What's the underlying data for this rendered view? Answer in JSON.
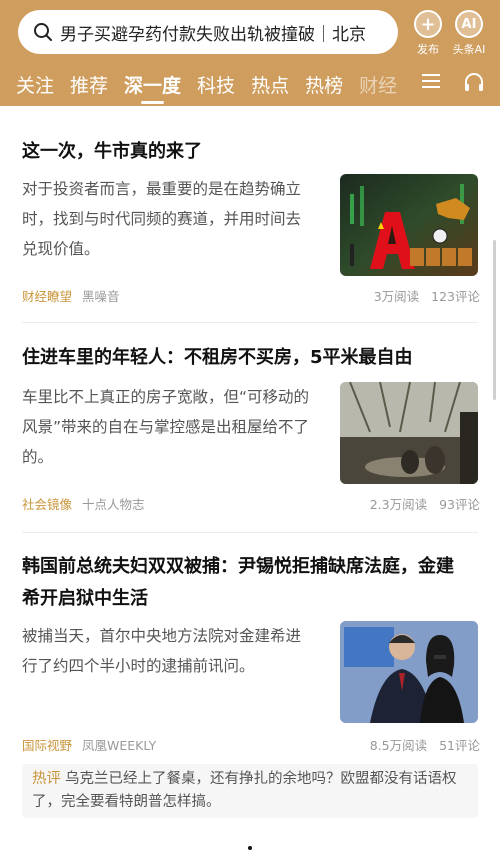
{
  "search": {
    "query": "男子买避孕药付款失败出轨被撞破｜北京"
  },
  "header_actions": [
    {
      "label": "发布",
      "glyph": "+"
    },
    {
      "label": "头条AI",
      "glyph": "AI"
    }
  ],
  "tabs": [
    {
      "label": "关注"
    },
    {
      "label": "推荐"
    },
    {
      "label": "深一度"
    },
    {
      "label": "科技"
    },
    {
      "label": "热点"
    },
    {
      "label": "热榜"
    },
    {
      "label": "财经"
    }
  ],
  "active_tab": "深一度",
  "articles": [
    {
      "title": "这一次，牛市真的来了",
      "summary": "对于投资者而言，最重要的是在趋势确立时，找到与时代同频的赛道，并用时间去兑现价值。",
      "category": "财经瞭望",
      "source": "黑噪音",
      "reads": "3万阅读",
      "comments": "123评论"
    },
    {
      "title": "住进车里的年轻人：不租房不买房，5平米最自由",
      "summary": "车里比不上真正的房子宽敞，但“可移动的风景”带来的自在与掌控感是出租屋给不了的。",
      "category": "社会镜像",
      "source": "十点人物志",
      "reads": "2.3万阅读",
      "comments": "93评论"
    },
    {
      "title": "韩国前总统夫妇双双被捕：尹锡悦拒捕缺席法庭，金建希开启狱中生活",
      "summary": "被捕当天，首尔中央地方法院对金建希进行了约四个半小时的逮捕前讯问。",
      "category": "国际视野",
      "source": "凤凰WEEKLY",
      "reads": "8.5万阅读",
      "comments": "51评论"
    }
  ],
  "hot_comment": {
    "tag": "热评",
    "text": "乌克兰已经上了餐桌，还有挣扎的余地吗？欧盟都没有话语权了，完全要看特朗普怎样搞。"
  },
  "colors": {
    "header": "#cf9d5e",
    "accent": "#c9953b"
  },
  "icons": [
    "search-icon",
    "plus-icon",
    "ai-icon",
    "menu-icon",
    "headphones-icon"
  ]
}
